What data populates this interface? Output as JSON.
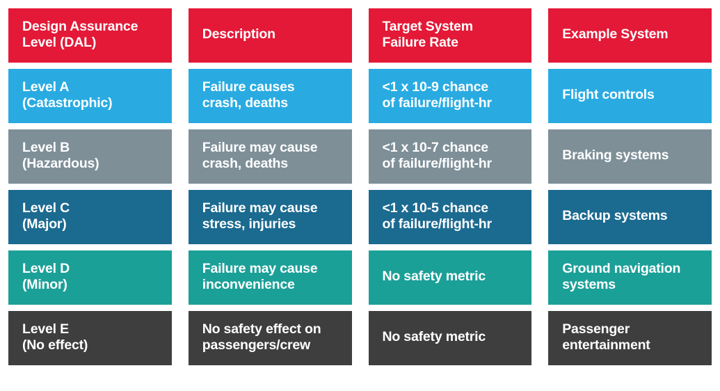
{
  "table": {
    "columns": [
      "Design Assurance\nLevel (DAL)",
      "Description",
      "Target System\nFailure Rate",
      "Example System"
    ],
    "header_color": "#e31937",
    "rows": [
      {
        "id": "level-a",
        "color": "#29abe2",
        "cells": [
          "Level A\n(Catastrophic)",
          "Failure causes\ncrash, deaths",
          "<1 x 10-9 chance\nof failure/flight-hr",
          "Flight controls"
        ]
      },
      {
        "id": "level-b",
        "color": "#7e8f98",
        "cells": [
          "Level B\n(Hazardous)",
          "Failure may cause\ncrash, deaths",
          "<1 x 10-7 chance\nof failure/flight-hr",
          "Braking systems"
        ]
      },
      {
        "id": "level-c",
        "color": "#1b6a90",
        "cells": [
          "Level C\n(Major)",
          "Failure may cause\nstress, injuries",
          "<1 x 10-5 chance\nof failure/flight-hr",
          "Backup systems"
        ]
      },
      {
        "id": "level-d",
        "color": "#1ba098",
        "cells": [
          "Level D\n(Minor)",
          "Failure may cause\ninconvenience",
          "No safety metric",
          "Ground navigation\nsystems"
        ]
      },
      {
        "id": "level-e",
        "color": "#3e3e3e",
        "cells": [
          "Level E\n(No effect)",
          "No safety effect on\npassengers/crew",
          "No safety metric",
          "Passenger\nentertainment"
        ]
      }
    ]
  }
}
